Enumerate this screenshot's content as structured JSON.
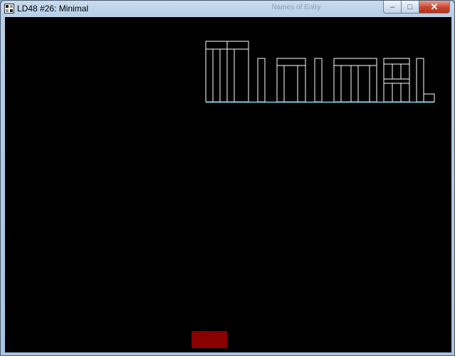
{
  "window": {
    "title": "LD48 #26: Minimal",
    "center_title": "Names of Entry",
    "controls": {
      "minimize": "–",
      "maximize": "□",
      "close": "✕"
    }
  },
  "game": {
    "logo_word": "Minimal",
    "logo_style": "outlined white letter blocks on cyan baseline",
    "background_color": "#000000",
    "logo_stroke_color": "#ffffff",
    "baseline_color": "#7fd8e8",
    "player_color": "#8b0000"
  }
}
